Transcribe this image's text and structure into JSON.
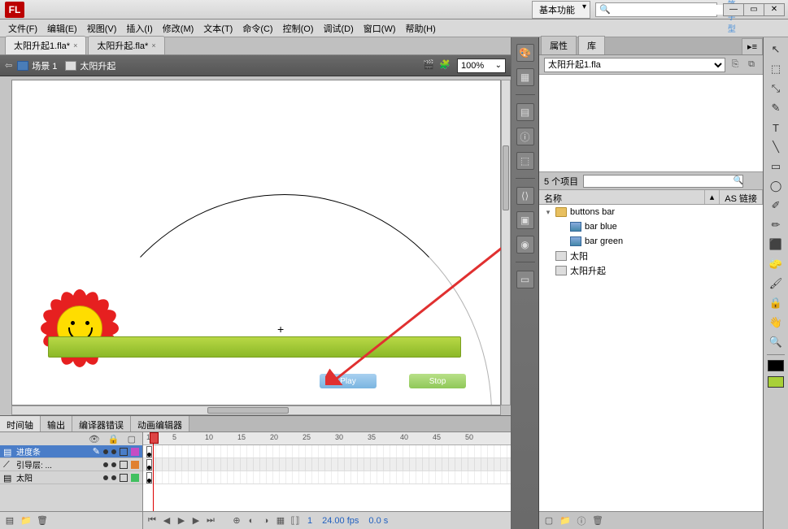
{
  "title": {
    "logo": "FL",
    "workspace": "基本功能",
    "search_hint": "五笔字型"
  },
  "menu": [
    "文件(F)",
    "编辑(E)",
    "视图(V)",
    "插入(I)",
    "修改(M)",
    "文本(T)",
    "命令(C)",
    "控制(O)",
    "调试(D)",
    "窗口(W)",
    "帮助(H)"
  ],
  "doc_tabs": [
    {
      "label": "太阳升起1.fla*",
      "active": true
    },
    {
      "label": "太阳升起.fla*",
      "active": false
    }
  ],
  "scene": {
    "back": "⇦",
    "scene_label": "场景 1",
    "clip_label": "太阳升起",
    "zoom": "100%"
  },
  "stage_buttons": {
    "play": "Play",
    "stop": "Stop"
  },
  "timeline": {
    "tabs": [
      "时间轴",
      "输出",
      "编译器错误",
      "动画编辑器"
    ],
    "ruler": [
      1,
      5,
      10,
      15,
      20,
      25,
      30,
      35,
      40,
      45,
      50
    ],
    "layers": [
      {
        "name": "进度条",
        "selected": true,
        "color": "#c44cc4"
      },
      {
        "name": "引导层: ...",
        "selected": false,
        "color": "#e08030",
        "guide": true
      },
      {
        "name": "太阳",
        "selected": false,
        "color": "#40c060"
      }
    ],
    "status": {
      "frame": "1",
      "fps": "24.00 fps",
      "time": "0.0 s"
    }
  },
  "panels": {
    "tabs": [
      "属性",
      "库"
    ],
    "lib_doc": "太阳升起1.fla",
    "item_count": "5 个项目",
    "cols": [
      "名称",
      "AS 链接"
    ],
    "items": [
      {
        "name": "buttons bar",
        "type": "folder",
        "depth": 0,
        "expanded": true
      },
      {
        "name": "bar blue",
        "type": "button",
        "depth": 1
      },
      {
        "name": "bar green",
        "type": "button",
        "depth": 1
      },
      {
        "name": "太阳",
        "type": "mc",
        "depth": 0
      },
      {
        "name": "太阳升起",
        "type": "mc",
        "depth": 0
      }
    ]
  },
  "tools": [
    "↖",
    "⬚",
    "⤡",
    "✎",
    "T",
    "╲",
    "▭",
    "◯",
    "✐",
    "✏",
    "⬛",
    "🧽",
    "🖌",
    "🔒",
    "👋",
    "🔍"
  ],
  "swatches": {
    "stroke": "#000000",
    "fill": "#a8d038"
  }
}
